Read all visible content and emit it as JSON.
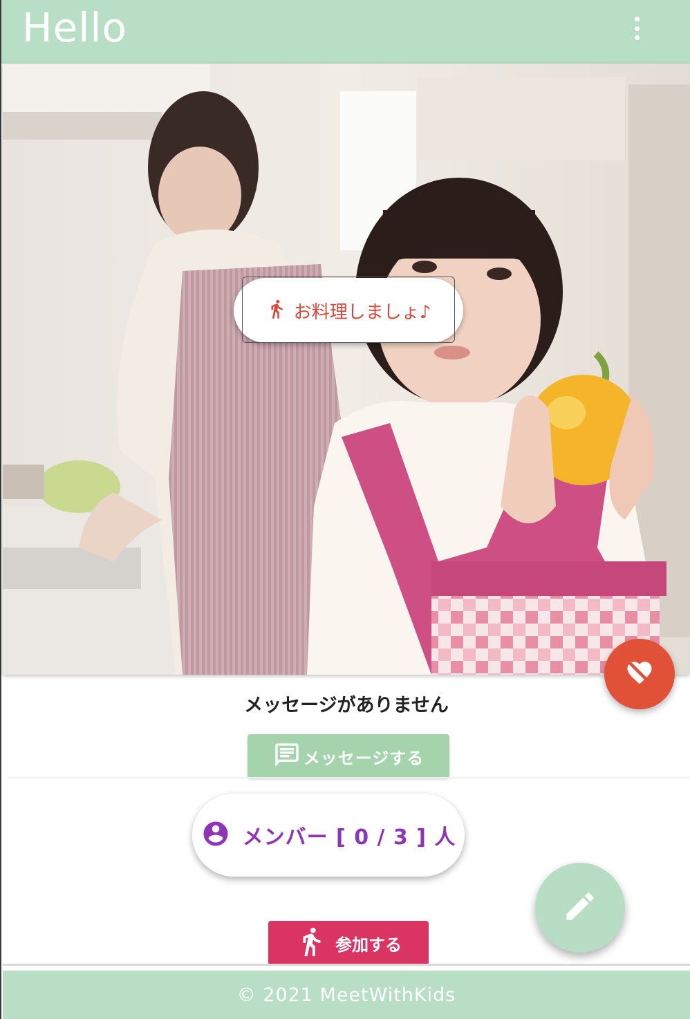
{
  "header": {
    "title": "Hello"
  },
  "hero": {
    "activity_label": "お料理しましょ♪"
  },
  "messages": {
    "empty_text": "メッセージがありません",
    "send_label": "メッセージする"
  },
  "members": {
    "label": "メンバー [ 0 / 3 ] 人"
  },
  "join": {
    "label": "参加する"
  },
  "footer": {
    "copyright": "© 2021  MeetWithKids"
  },
  "icons": {
    "menu": "more-vert-icon",
    "activity": "directions-run-icon",
    "like": "heart-broken-icon",
    "message": "comment-icon",
    "member": "account-circle-icon",
    "edit": "edit-pencil-icon",
    "join": "directions-run-icon"
  },
  "colors": {
    "appbar": "#b8dec5",
    "like_fab": "#e05138",
    "message_button": "#a4d3ac",
    "member_text": "#8e35b5",
    "join_button": "#d93462",
    "edit_fab": "#b7dec4",
    "activity_text": "#d9483b"
  }
}
